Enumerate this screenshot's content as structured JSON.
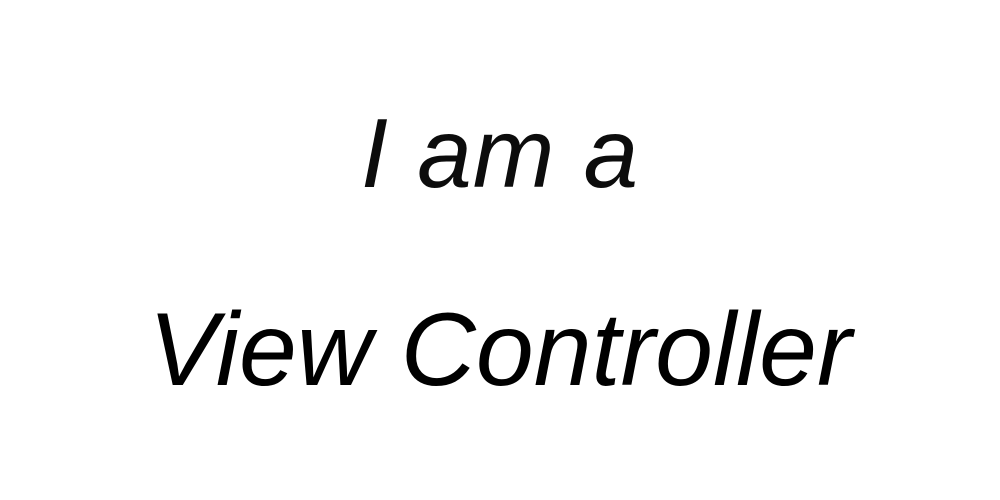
{
  "screen": {
    "line1": "I am a",
    "line2": "View Controller"
  },
  "colors": {
    "background": "#ffffff",
    "text": "#000000"
  }
}
